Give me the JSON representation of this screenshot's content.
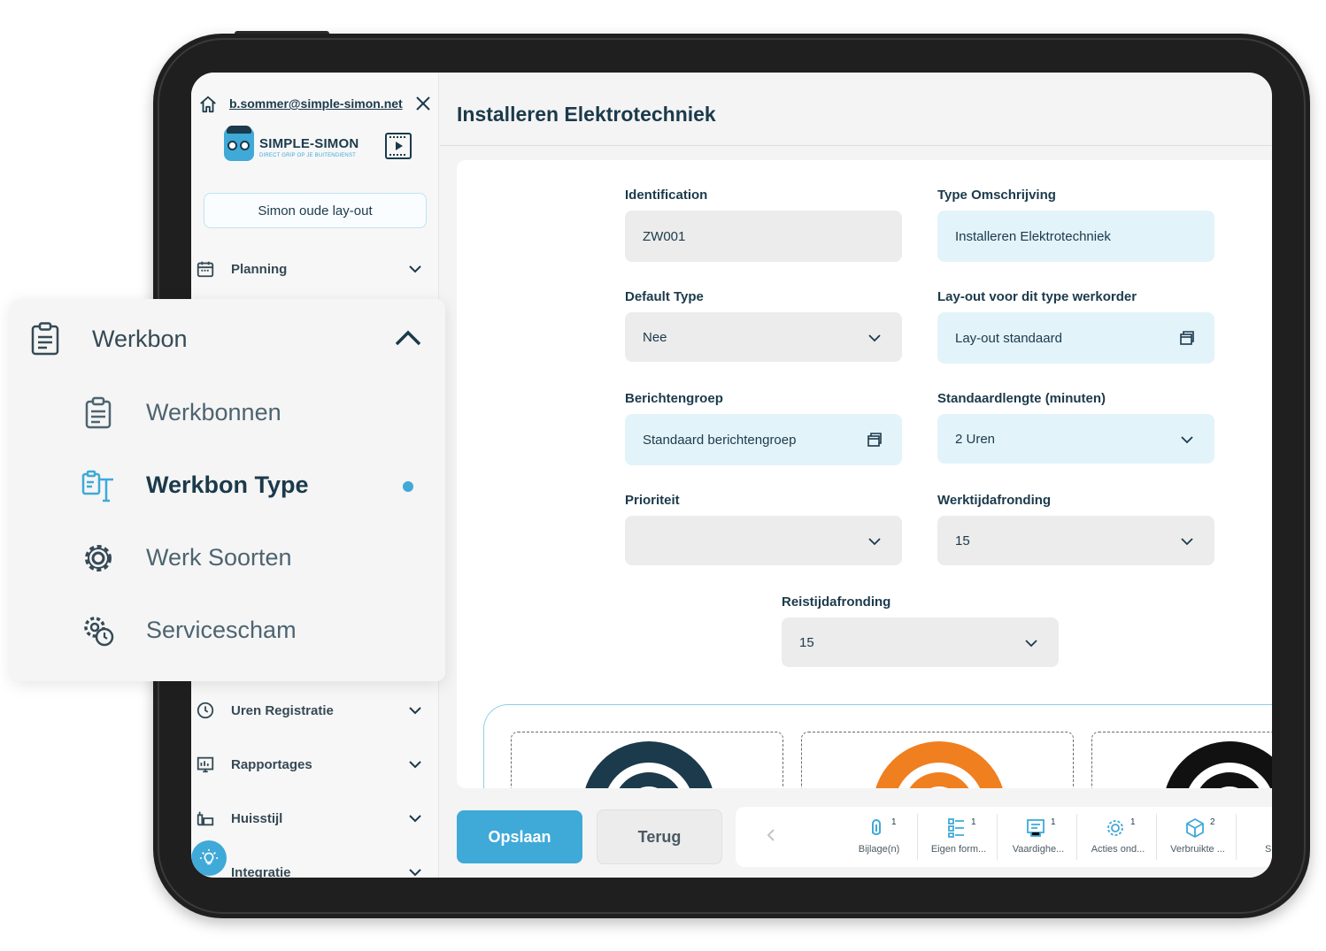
{
  "sidebar": {
    "email": "b.sommer@simple-simon.net",
    "logo_text": "SIMPLE-SIMON",
    "logo_subtitle": "DIRECT GRIP OP JE BUITENDIENST",
    "layout_button": "Simon oude lay-out",
    "items": [
      {
        "label": "Planning",
        "icon": "calendar-icon"
      },
      {
        "label": "Uren Registratie",
        "icon": "clock-icon"
      },
      {
        "label": "Rapportages",
        "icon": "report-icon"
      },
      {
        "label": "Huisstijl",
        "icon": "style-icon"
      },
      {
        "label": "Integratie",
        "icon": "integration-icon"
      }
    ]
  },
  "werkbon_menu": {
    "header": "Werkbon",
    "items": [
      {
        "label": "Werkbonnen",
        "icon": "clipboard-icon",
        "active": false
      },
      {
        "label": "Werkbon Type",
        "icon": "type-icon",
        "active": true
      },
      {
        "label": "Werk Soorten",
        "icon": "gear-icon",
        "active": false
      },
      {
        "label": "Servicescham",
        "icon": "gear-clock-icon",
        "active": false
      }
    ]
  },
  "main": {
    "title": "Installeren Elektrotechniek",
    "fields": {
      "identification": {
        "label": "Identification",
        "value": "ZW001"
      },
      "type_omschrijving": {
        "label": "Type Omschrijving",
        "value": "Installeren Elektrotechniek"
      },
      "default_type": {
        "label": "Default Type",
        "value": "Nee"
      },
      "layout": {
        "label": "Lay-out voor dit type werkorder",
        "value": "Lay-out standaard"
      },
      "berichtengroep": {
        "label": "Berichtengroep",
        "value": "Standaard berichtengroep"
      },
      "standaardlengte": {
        "label": "Standaardlengte (minuten)",
        "value": "2 Uren"
      },
      "prioriteit": {
        "label": "Prioriteit",
        "value": ""
      },
      "werktijdafronding": {
        "label": "Werktijdafronding",
        "value": "15"
      },
      "reistijdafronding": {
        "label": "Reistijdafronding",
        "value": "15"
      }
    },
    "gallery_colors": [
      "#1b3a4b",
      "#f07f1f",
      "#111111"
    ]
  },
  "bottom": {
    "save": "Opslaan",
    "back": "Terug",
    "tabs": [
      {
        "label": "Bijlage(n)",
        "count": "1",
        "icon": "paperclip-icon"
      },
      {
        "label": "Eigen form...",
        "count": "1",
        "icon": "form-icon"
      },
      {
        "label": "Vaardighe...",
        "count": "1",
        "icon": "skills-icon"
      },
      {
        "label": "Acties ond...",
        "count": "1",
        "icon": "gear-icon"
      },
      {
        "label": "Verbruikte ...",
        "count": "2",
        "icon": "box-icon"
      }
    ],
    "tab_overflow": "S"
  },
  "colors": {
    "accent": "#3fa9d8",
    "dark": "#1b3a4b",
    "field_blue": "#e3f3fa",
    "field_grey": "#ececec"
  }
}
